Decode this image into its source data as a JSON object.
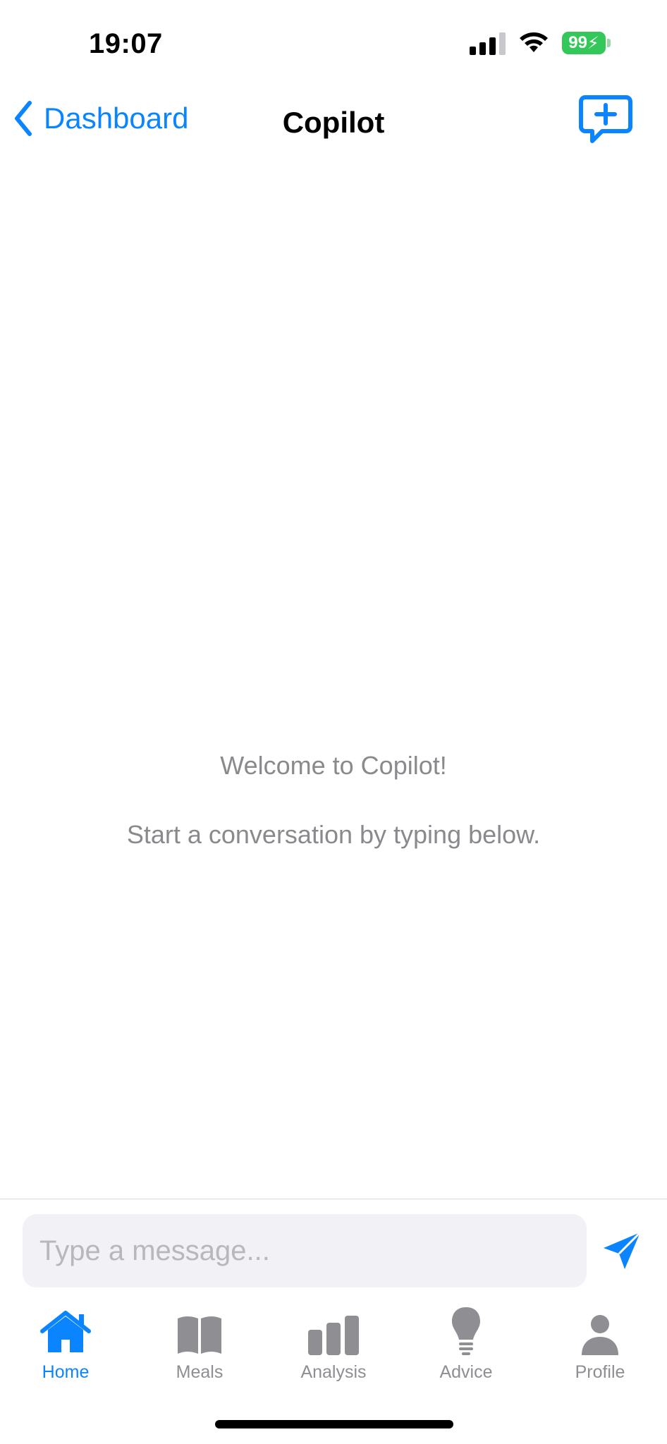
{
  "status_bar": {
    "time": "19:07",
    "battery": "99"
  },
  "nav": {
    "back_label": "Dashboard",
    "title": "Copilot"
  },
  "empty_state": {
    "welcome": "Welcome to Copilot!",
    "hint": "Start a conversation by typing below."
  },
  "composer": {
    "placeholder": "Type a message..."
  },
  "tabs": [
    {
      "label": "Home",
      "icon": "house-icon",
      "active": true
    },
    {
      "label": "Meals",
      "icon": "book-icon",
      "active": false
    },
    {
      "label": "Analysis",
      "icon": "bar-chart-icon",
      "active": false
    },
    {
      "label": "Advice",
      "icon": "lightbulb-icon",
      "active": false
    },
    {
      "label": "Profile",
      "icon": "person-icon",
      "active": false
    }
  ],
  "colors": {
    "accent": "#0a84ff",
    "inactive": "#8e8e93",
    "battery": "#34c759",
    "placeholder": "#b7b7bc"
  }
}
